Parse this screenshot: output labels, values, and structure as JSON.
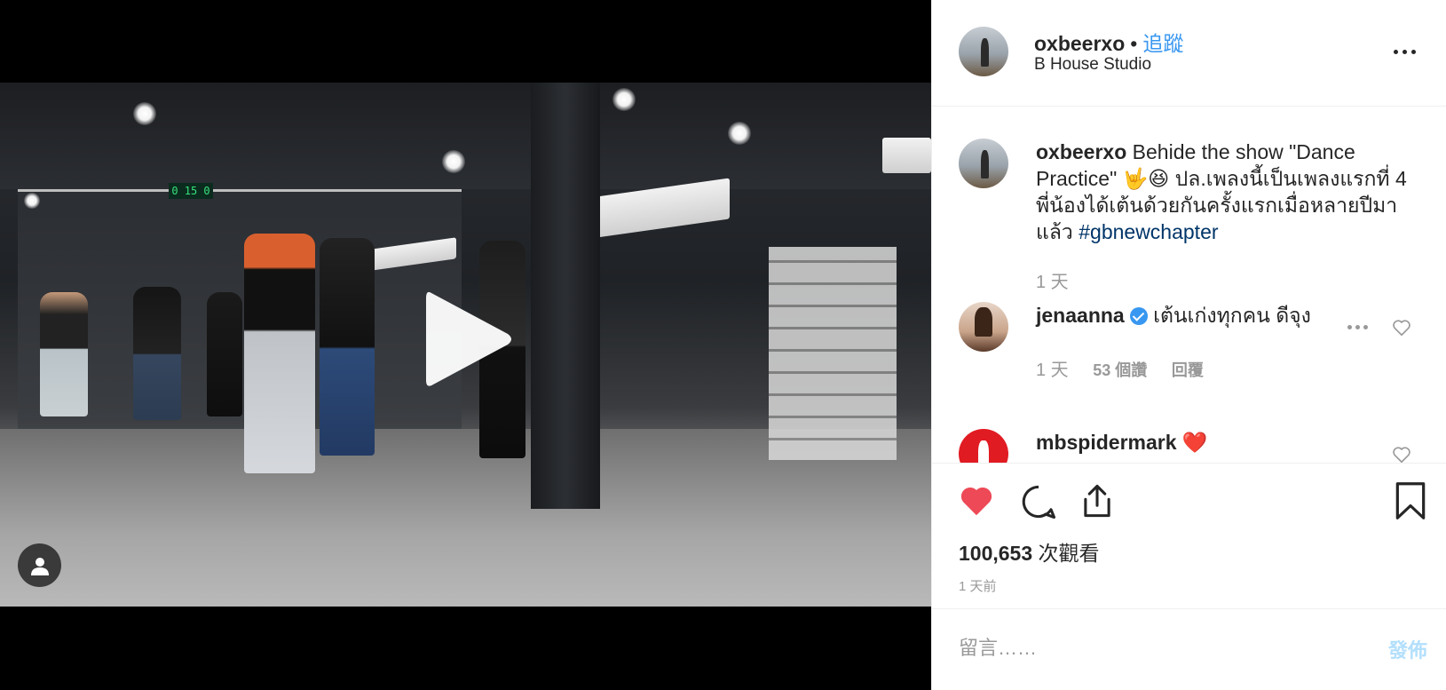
{
  "post": {
    "username": "oxbeerxo",
    "separator": "•",
    "follow_label": "追蹤",
    "location": "B House Studio"
  },
  "caption": {
    "username": "oxbeerxo",
    "text": "Behide the show \"Dance Practice\" 🤟😆 ปล.เพลงนี้เป็นเพลงแรกที่ 4 พี่น้องได้เต้นด้วยกันครั้งแรกเมื่อหลายปีมาแล้ว",
    "hashtag": "#gbnewchapter",
    "age": "1 天"
  },
  "comments": [
    {
      "username": "jenaanna",
      "verified": true,
      "text": "เต้นเก่งทุกคน ดีจุง",
      "age": "1 天",
      "likes": "53 個讚",
      "reply_label": "回覆"
    },
    {
      "username": "mbspidermark",
      "text": "❤️"
    }
  ],
  "stats": {
    "views_count": "100,653",
    "views_label": "次觀看",
    "timestamp": "1 天前"
  },
  "comment_box": {
    "placeholder": "留言……",
    "post_label": "發佈"
  },
  "video": {
    "clock_text": "0 15 0"
  },
  "icons": {
    "like": "heart-icon",
    "comment": "comment-bubble-icon",
    "share": "share-icon",
    "save": "bookmark-icon",
    "play": "play-icon",
    "user_tag": "person-icon"
  },
  "colors": {
    "like_red": "#ed4956",
    "link_blue": "#3897f0",
    "hashtag_blue": "#003569",
    "muted_gray": "#999999",
    "post_disabled": "#b2dffc"
  }
}
